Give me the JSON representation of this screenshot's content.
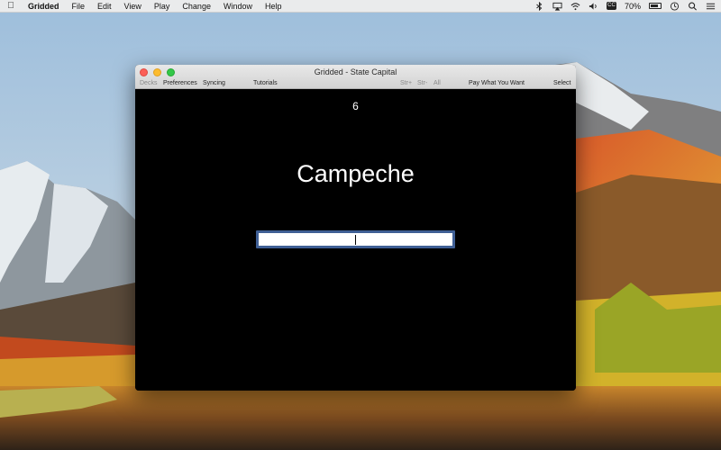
{
  "menubar": {
    "app_name": "Gridded",
    "items": [
      "File",
      "Edit",
      "View",
      "Play",
      "Change",
      "Window",
      "Help"
    ],
    "battery_percent": "70%",
    "cc_label": "CC"
  },
  "window": {
    "title": "Gridded - State Capital",
    "toolbar": {
      "decks": "Decks",
      "preferences": "Preferences",
      "syncing": "Syncing",
      "tutorials": "Tutorials",
      "str_plus": "Str+",
      "str_minus": "Str-",
      "all": "All",
      "pay": "Pay What You Want",
      "select": "Select"
    },
    "counter": "6",
    "prompt": "Campeche",
    "answer_value": ""
  }
}
